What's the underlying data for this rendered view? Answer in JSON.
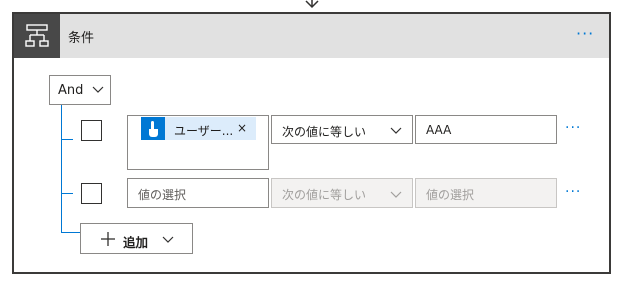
{
  "card": {
    "title": "条件",
    "more_label": "···",
    "header_icon": "condition-icon",
    "accent_color": "#0078d4",
    "header_bg": "#e1e1e1"
  },
  "group": {
    "operator": "And"
  },
  "rows": [
    {
      "left_token": "ユーザー...",
      "token_icon": "touch-icon",
      "token_remove": "×",
      "operator": "次の値に等しい",
      "right_value": "AAA",
      "more_label": "···"
    },
    {
      "left_placeholder": "値の選択",
      "operator": "次の値に等しい",
      "right_placeholder": "値の選択",
      "more_label": "···"
    }
  ],
  "add_button": {
    "label": "追加"
  }
}
